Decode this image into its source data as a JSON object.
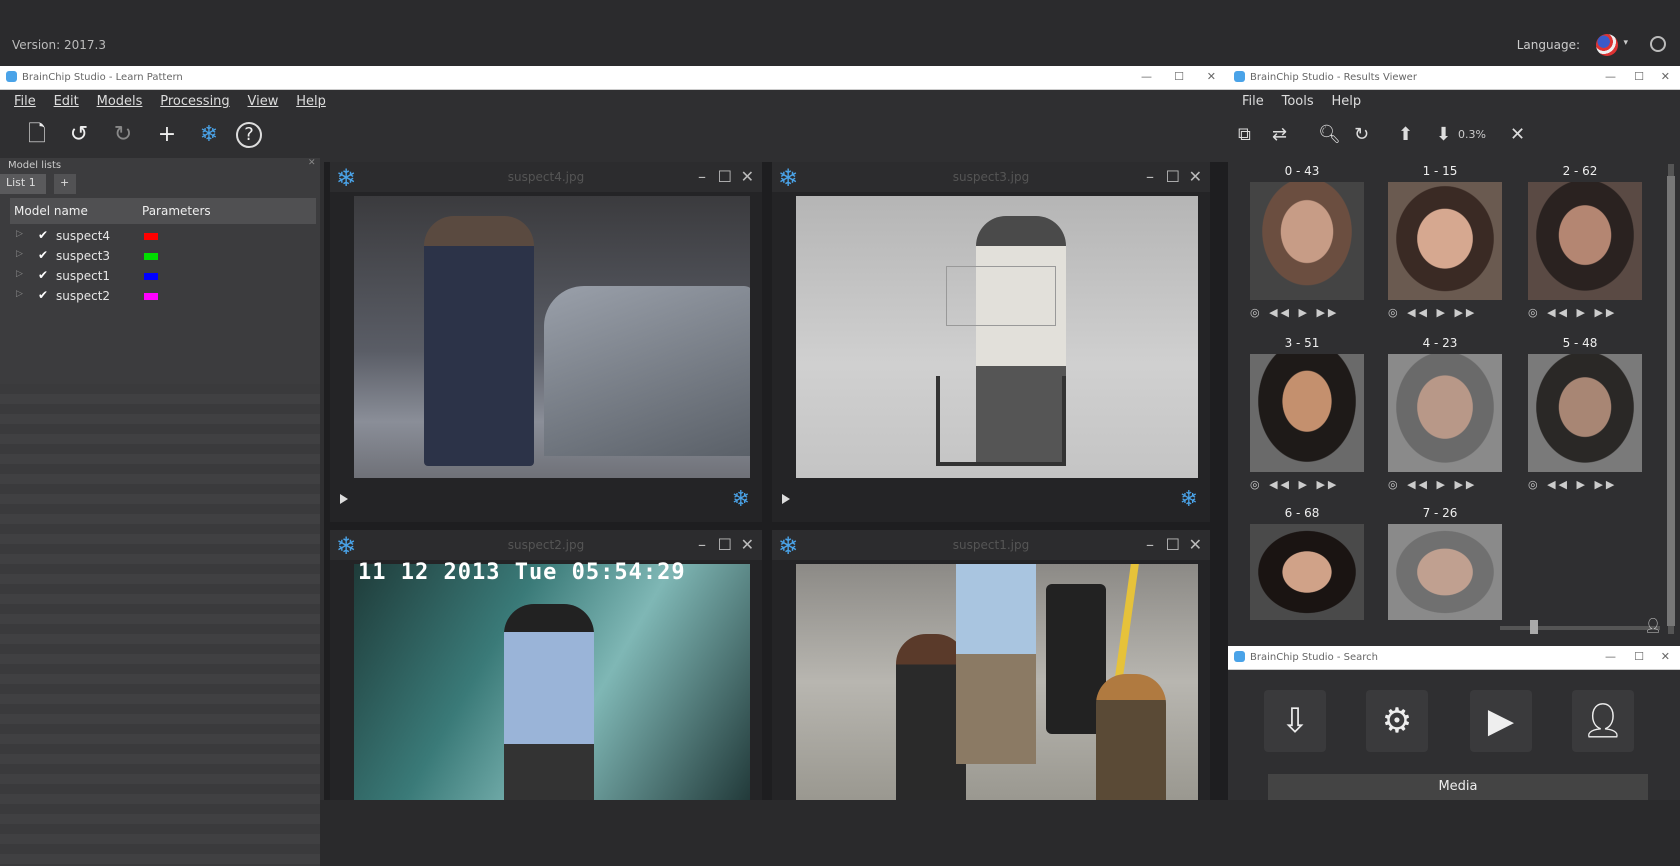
{
  "top": {
    "version": "Version: 2017.3",
    "language_label": "Language:",
    "flag_icon": "us-flag-icon",
    "power_icon": "power-icon"
  },
  "main_window": {
    "title": "BrainChip Studio - Learn Pattern",
    "menu": [
      "File",
      "Edit",
      "Models",
      "Processing",
      "View",
      "Help"
    ],
    "toolbar_icons": [
      "new-document-icon",
      "undo-icon",
      "redo-icon",
      "plus-icon",
      "snowflake-icon",
      "help-icon"
    ],
    "left_panel": {
      "header": "Model lists",
      "tabs": [
        "List 1",
        "+"
      ],
      "columns": [
        "Model name",
        "Parameters"
      ],
      "models": [
        {
          "name": "suspect4",
          "color": "#ff0000"
        },
        {
          "name": "suspect3",
          "color": "#00dd00"
        },
        {
          "name": "suspect1",
          "color": "#0000ff"
        },
        {
          "name": "suspect2",
          "color": "#ff00ff"
        }
      ]
    },
    "viewers": [
      {
        "name": "suspect4.jpg"
      },
      {
        "name": "suspect3.jpg"
      },
      {
        "name": "suspect2.jpg",
        "timestamp": "11 12 2013 Tue 05:54:29"
      },
      {
        "name": "suspect1.jpg"
      }
    ]
  },
  "results_window": {
    "title": "BrainChip Studio - Results Viewer",
    "menu": [
      "File",
      "Tools",
      "Help"
    ],
    "zoom": "0.3%",
    "faces": [
      {
        "label": "0 - 43"
      },
      {
        "label": "1 - 15"
      },
      {
        "label": "2 - 62"
      },
      {
        "label": "3 - 51"
      },
      {
        "label": "4 - 23"
      },
      {
        "label": "5 - 48"
      },
      {
        "label": "6 - 68"
      },
      {
        "label": "7 - 26"
      }
    ]
  },
  "search_window": {
    "title": "BrainChip Studio - Search",
    "media_label": "Media"
  }
}
